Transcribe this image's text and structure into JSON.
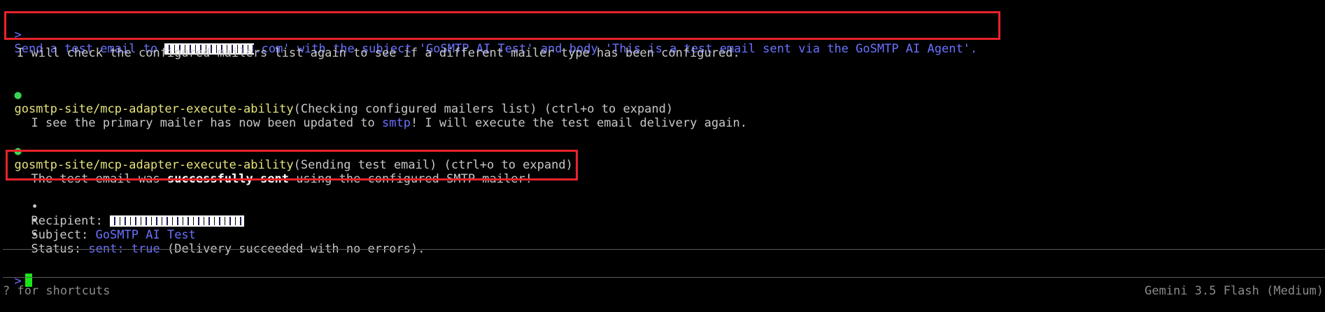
{
  "prompt_line": {
    "caret": ">",
    "part1": "Send a test email to ",
    "part2": ".com' with the subject 'GoSMTP AI Test' and body 'This is a test email sent via the GoSMTP AI Agent'."
  },
  "messages": {
    "m1": "I will check the configured mailers list again to see if a different mailer type has been configured.",
    "tool1_name": "gosmtp-site/mcp-adapter-execute-ability",
    "tool1_args": "(Checking configured mailers list)",
    "tool1_hint": " (ctrl+o to expand)",
    "m2_pre": "I see the primary mailer has now been updated to ",
    "m2_hl": "smtp",
    "m2_post": "! I will execute the test email delivery again.",
    "tool2_name": "gosmtp-site/mcp-adapter-execute-ability",
    "tool2_args": "(Sending test email)",
    "tool2_hint": " (ctrl+o to expand)",
    "m3_pre": "The test email was ",
    "m3_bold": "successfully sent",
    "m3_post": " using the configured SMTP mailer!"
  },
  "details": {
    "bullet": "•",
    "recipient_label": "Recipient: ",
    "subject_label": "Subject: ",
    "subject_value": "GoSMTP AI Test",
    "status_label": "Status: ",
    "status_value": "sent: true",
    "status_note": " (Delivery succeeded with no errors)."
  },
  "input": {
    "caret": ">"
  },
  "footer": {
    "shortcuts_hint": "? for shortcuts",
    "model": "Gemini 3.5 Flash (Medium)"
  },
  "colors": {
    "accent_blue": "#6a72ff",
    "tool_yellow": "#e6e37a",
    "status_green": "#39d353",
    "highlight_red": "#e8232a",
    "cursor_green": "#19e619"
  },
  "icons": {
    "status_dot": "●"
  }
}
